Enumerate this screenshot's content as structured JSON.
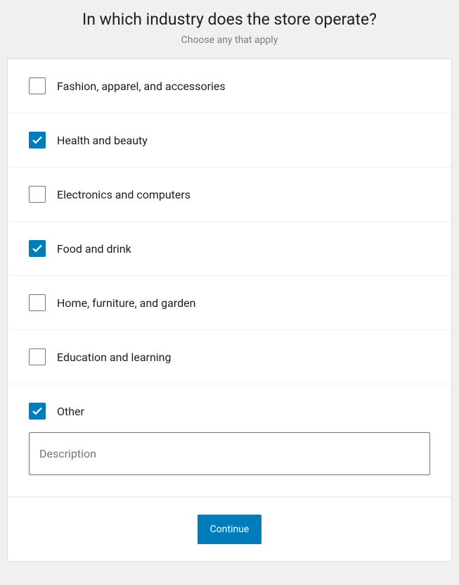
{
  "header": {
    "title": "In which industry does the store operate?",
    "subtitle": "Choose any that apply"
  },
  "options": [
    {
      "label": "Fashion, apparel, and accessories",
      "checked": false
    },
    {
      "label": "Health and beauty",
      "checked": true
    },
    {
      "label": "Electronics and computers",
      "checked": false
    },
    {
      "label": "Food and drink",
      "checked": true
    },
    {
      "label": "Home, furniture, and garden",
      "checked": false
    },
    {
      "label": "Education and learning",
      "checked": false
    },
    {
      "label": "Other",
      "checked": true
    }
  ],
  "description": {
    "placeholder": "Description",
    "value": ""
  },
  "footer": {
    "continue_label": "Continue"
  }
}
